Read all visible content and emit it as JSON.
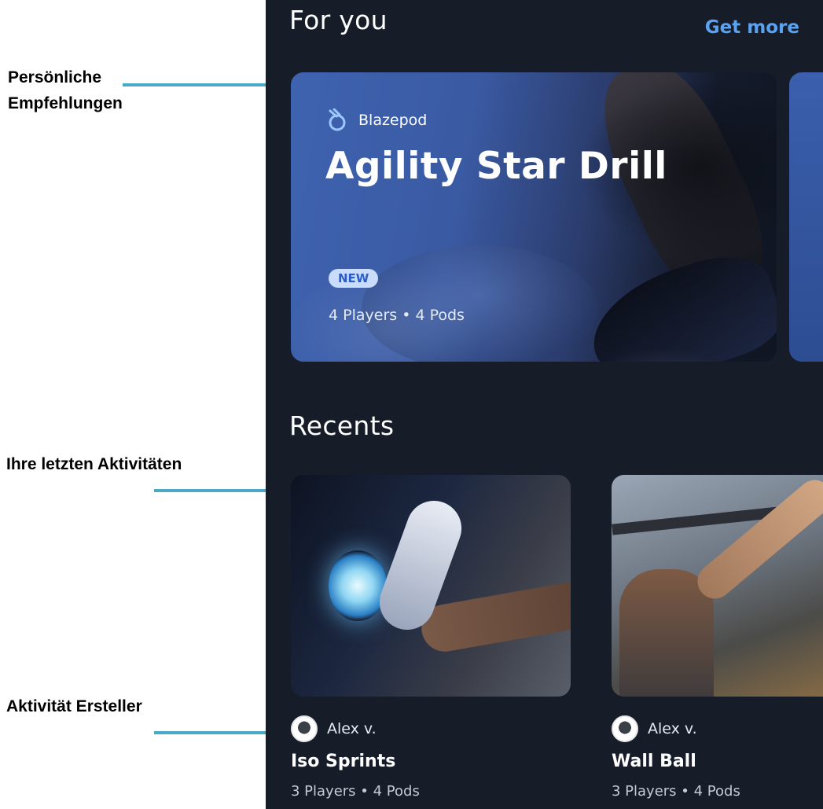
{
  "annotations": [
    {
      "id": "recommendations",
      "label": "Persönliche\nEmpfehlungen"
    },
    {
      "id": "recents",
      "label": "Ihre letzten Aktivitäten"
    },
    {
      "id": "creator",
      "label": "Aktivität Ersteller"
    }
  ],
  "colors": {
    "callout": "#4aa9c4",
    "screen_bg": "#161d28",
    "accent": "#5aa2f2",
    "badge_bg": "#c9dcfb",
    "badge_text": "#2c5cc8"
  },
  "for_you": {
    "title": "For you",
    "get_more": "Get more",
    "featured": {
      "brand_icon": "blazepod-logo-icon",
      "brand": "Blazepod",
      "title": "Agility Star Drill",
      "badge": "NEW",
      "meta": "4 Players • 4 Pods"
    }
  },
  "recents": {
    "title": "Recents",
    "items": [
      {
        "creator": "Alex v.",
        "title": "Iso Sprints",
        "meta": "3 Players • 4 Pods"
      },
      {
        "creator": "Alex v.",
        "title": "Wall Ball",
        "meta": "3 Players • 4 Pods"
      }
    ]
  }
}
